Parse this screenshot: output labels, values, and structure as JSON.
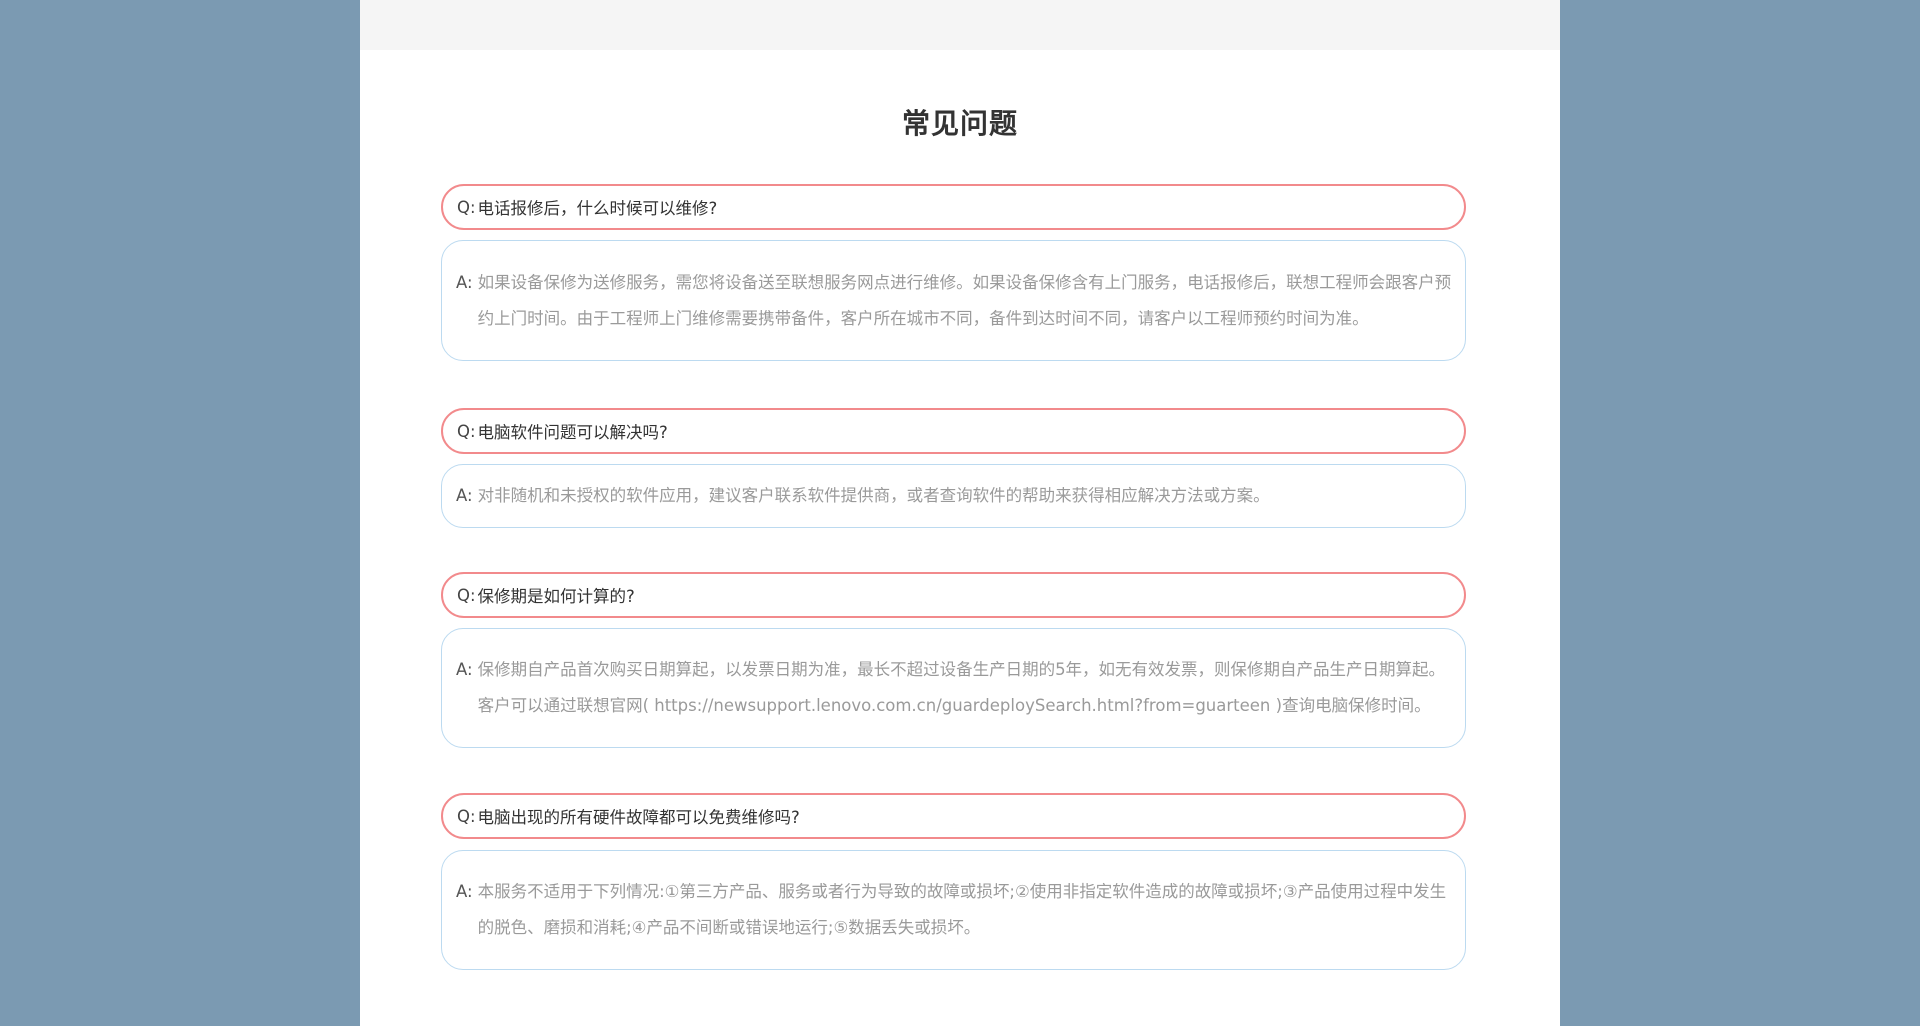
{
  "page": {
    "title": "常见问题"
  },
  "colors": {
    "background": "#7b9ab2",
    "question_border": "#f28a8c",
    "answer_border": "#bcdaf0",
    "answer_text": "#9a9a9a"
  },
  "faq": {
    "question_label": "Q:",
    "answer_label": "A:",
    "items": [
      {
        "question": "电话报修后，什么时候可以维修?",
        "answer": "如果设备保修为送修服务，需您将设备送至联想服务网点进行维修。如果设备保修含有上门服务，电话报修后，联想工程师会跟客户预约上门时间。由于工程师上门维修需要携带备件，客户所在城市不同，备件到达时间不同，请客户以工程师预约时间为准。"
      },
      {
        "question": "电脑软件问题可以解决吗?",
        "answer": "对非随机和未授权的软件应用，建议客户联系软件提供商，或者查询软件的帮助来获得相应解决方法或方案。"
      },
      {
        "question": "保修期是如何计算的?",
        "answer": "保修期自产品首次购买日期算起，以发票日期为准，最长不超过设备生产日期的5年，如无有效发票，则保修期自产品生产日期算起。客户可以通过联想官网( https://newsupport.lenovo.com.cn/guardeploySearch.html?from=guarteen )查询电脑保修时间。"
      },
      {
        "question": "电脑出现的所有硬件故障都可以免费维修吗?",
        "answer": "本服务不适用于下列情况:①第三方产品、服务或者行为导致的故障或损坏;②使用非指定软件造成的故障或损坏;③产品使用过程中发生的脱色、磨损和消耗;④产品不间断或错误地运行;⑤数据丢失或损坏。"
      }
    ]
  }
}
